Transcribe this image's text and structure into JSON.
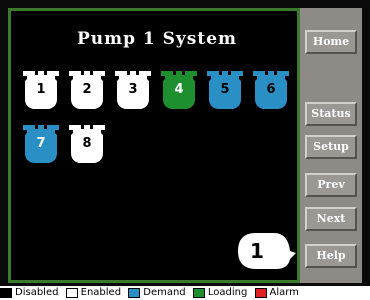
{
  "screen": {
    "title": "Pump 1 System"
  },
  "pumps": [
    {
      "label": "1",
      "status": "Enabled",
      "color": "#ffffff",
      "text_color": "#000000"
    },
    {
      "label": "2",
      "status": "Enabled",
      "color": "#ffffff",
      "text_color": "#000000"
    },
    {
      "label": "3",
      "status": "Enabled",
      "color": "#ffffff",
      "text_color": "#000000"
    },
    {
      "label": "4",
      "status": "Loading",
      "color": "#1e8f2e",
      "text_color": "#ffffff"
    },
    {
      "label": "5",
      "status": "Demand",
      "color": "#2a8fc4",
      "text_color": "#000000"
    },
    {
      "label": "6",
      "status": "Demand",
      "color": "#2a8fc4",
      "text_color": "#000000"
    },
    {
      "label": "7",
      "status": "Demand",
      "color": "#2a8fc4",
      "text_color": "#ffffff"
    },
    {
      "label": "8",
      "status": "Enabled",
      "color": "#ffffff",
      "text_color": "#000000"
    }
  ],
  "indicator": {
    "value": "1"
  },
  "buttons": {
    "home": "Home",
    "status": "Status",
    "setup": "Setup",
    "prev": "Prev",
    "next": "Next",
    "help": "Help"
  },
  "legend": [
    {
      "label": "Disabled",
      "color": "#000000"
    },
    {
      "label": "Enabled",
      "color": "#ffffff"
    },
    {
      "label": "Demand",
      "color": "#2a8fc4"
    },
    {
      "label": "Loading",
      "color": "#1e8f2e"
    },
    {
      "label": "Alarm",
      "color": "#e02020"
    }
  ],
  "colors": {
    "screen_border": "#3a7a2c",
    "panel": "#8e8b87"
  }
}
